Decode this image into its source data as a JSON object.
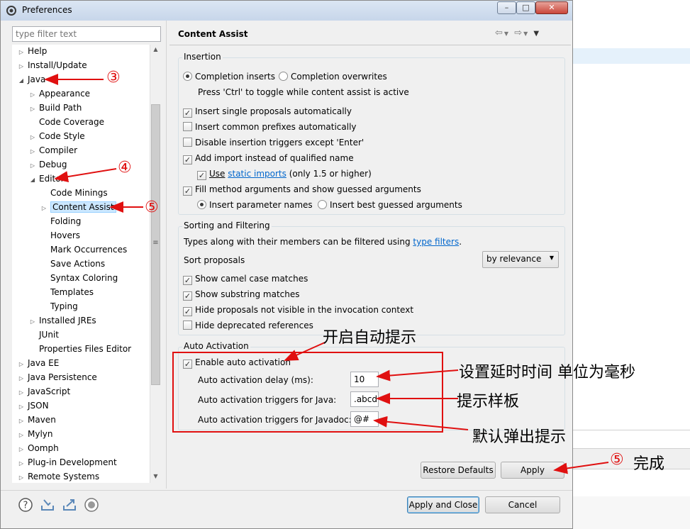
{
  "window": {
    "title": "Preferences",
    "filter_placeholder": "type filter text"
  },
  "tree": {
    "items": [
      {
        "label": "Help",
        "level": 0,
        "expander": "collapsed"
      },
      {
        "label": "Install/Update",
        "level": 0,
        "expander": "collapsed"
      },
      {
        "label": "Java",
        "level": 0,
        "expander": "expanded"
      },
      {
        "label": "Appearance",
        "level": 1,
        "expander": "collapsed"
      },
      {
        "label": "Build Path",
        "level": 1,
        "expander": "collapsed"
      },
      {
        "label": "Code Coverage",
        "level": 1,
        "expander": "none"
      },
      {
        "label": "Code Style",
        "level": 1,
        "expander": "collapsed"
      },
      {
        "label": "Compiler",
        "level": 1,
        "expander": "collapsed"
      },
      {
        "label": "Debug",
        "level": 1,
        "expander": "collapsed"
      },
      {
        "label": "Editor",
        "level": 1,
        "expander": "expanded"
      },
      {
        "label": "Code Minings",
        "level": 2,
        "expander": "none"
      },
      {
        "label": "Content Assist",
        "level": 2,
        "expander": "collapsed",
        "selected": true
      },
      {
        "label": "Folding",
        "level": 2,
        "expander": "none"
      },
      {
        "label": "Hovers",
        "level": 2,
        "expander": "none"
      },
      {
        "label": "Mark Occurrences",
        "level": 2,
        "expander": "none"
      },
      {
        "label": "Save Actions",
        "level": 2,
        "expander": "none"
      },
      {
        "label": "Syntax Coloring",
        "level": 2,
        "expander": "none"
      },
      {
        "label": "Templates",
        "level": 2,
        "expander": "none"
      },
      {
        "label": "Typing",
        "level": 2,
        "expander": "none"
      },
      {
        "label": "Installed JREs",
        "level": 1,
        "expander": "collapsed"
      },
      {
        "label": "JUnit",
        "level": 1,
        "expander": "none"
      },
      {
        "label": "Properties Files Editor",
        "level": 1,
        "expander": "none"
      },
      {
        "label": "Java EE",
        "level": 0,
        "expander": "collapsed"
      },
      {
        "label": "Java Persistence",
        "level": 0,
        "expander": "collapsed"
      },
      {
        "label": "JavaScript",
        "level": 0,
        "expander": "collapsed"
      },
      {
        "label": "JSON",
        "level": 0,
        "expander": "collapsed"
      },
      {
        "label": "Maven",
        "level": 0,
        "expander": "collapsed"
      },
      {
        "label": "Mylyn",
        "level": 0,
        "expander": "collapsed"
      },
      {
        "label": "Oomph",
        "level": 0,
        "expander": "collapsed"
      },
      {
        "label": "Plug-in Development",
        "level": 0,
        "expander": "collapsed"
      },
      {
        "label": "Remote Systems",
        "level": 0,
        "expander": "collapsed"
      }
    ]
  },
  "page": {
    "title": "Content Assist",
    "insertion": {
      "label": "Insertion",
      "radio_inserts": "Completion inserts",
      "radio_overwrites": "Completion overwrites",
      "hint": "Press 'Ctrl' to toggle while content assist is active",
      "cb_single": "Insert single proposals automatically",
      "cb_common": "Insert common prefixes automatically",
      "cb_disable": "Disable insertion triggers except 'Enter'",
      "cb_import": "Add import instead of qualified name",
      "use_prefix": "Use",
      "use_link": "static imports",
      "use_suffix": "(only 1.5 or higher)",
      "cb_fill": "Fill method arguments and show guessed arguments",
      "radio_param_names": "Insert parameter names",
      "radio_best_guessed": "Insert best guessed arguments"
    },
    "sorting": {
      "label": "Sorting and Filtering",
      "types_prefix": "Types along with their members can be filtered using",
      "types_link": "type filters",
      "types_suffix": ".",
      "sort_label": "Sort proposals",
      "sort_value": "by relevance",
      "cb_camel": "Show camel case matches",
      "cb_substring": "Show substring matches",
      "cb_hide_invisible": "Hide proposals not visible in the invocation context",
      "cb_hide_deprecated": "Hide deprecated references"
    },
    "auto": {
      "label": "Auto Activation",
      "cb_enable": "Enable auto activation",
      "delay_label": "Auto activation delay (ms):",
      "delay_value": "10",
      "java_label": "Auto activation triggers for Java:",
      "java_value": ".abcd",
      "javadoc_label": "Auto activation triggers for Javadoc:",
      "javadoc_value": "@#"
    },
    "restore_defaults": "Restore Defaults",
    "apply": "Apply"
  },
  "footer": {
    "apply_close": "Apply and Close",
    "cancel": "Cancel"
  },
  "annotations": {
    "n3": "③",
    "n4": "④",
    "n5": "⑤",
    "n5b": "⑤",
    "done": "完成",
    "enable": "开启自动提示",
    "delay": "设置延时时间 单位为毫秒",
    "template": "提示样板",
    "default": "默认弹出提示"
  },
  "colors": {
    "annotation_red": "#e01010",
    "selection": "#cce8ff",
    "link": "#0066cc"
  }
}
